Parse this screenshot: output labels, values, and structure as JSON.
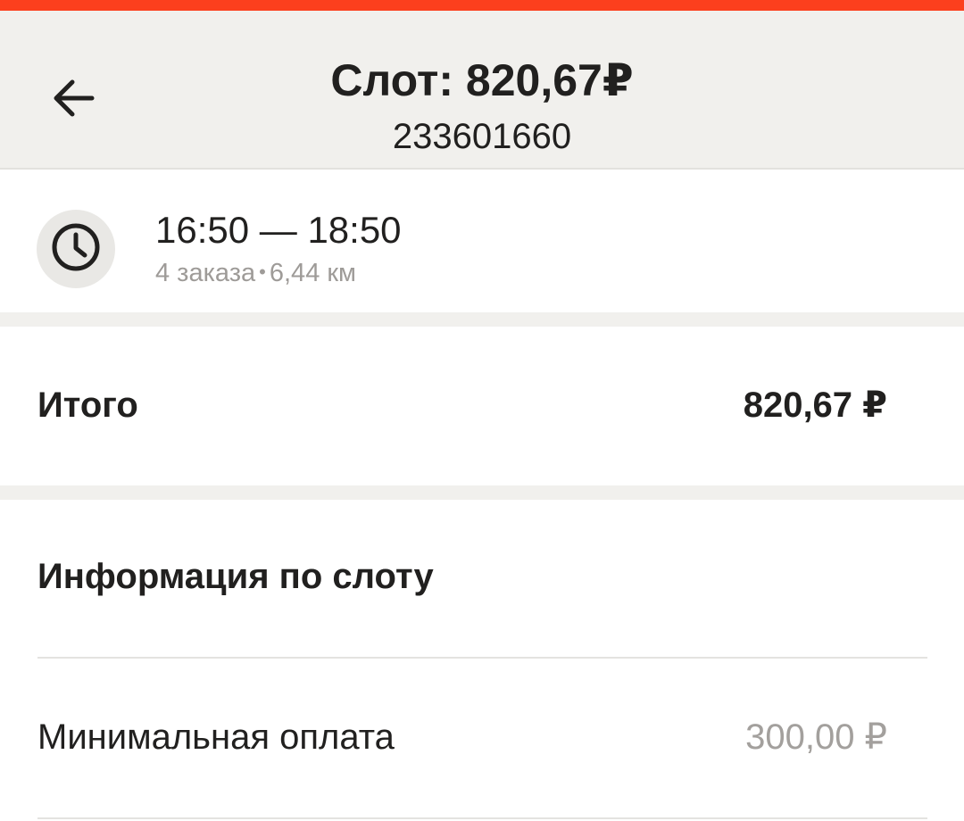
{
  "colors": {
    "accent": "#fc3f1d",
    "header_bg": "#f1f0ed",
    "secondary_text": "#9e9b98"
  },
  "header": {
    "back_icon": "arrow-left-icon",
    "title": "Слот: 820,67₽",
    "subtitle": "233601660"
  },
  "slot": {
    "icon": "clock-icon",
    "time_range": "16:50 — 18:50",
    "orders": "4 заказа",
    "separator": "•",
    "distance": "6,44 км"
  },
  "total": {
    "label": "Итого",
    "value": "820,67 ₽"
  },
  "info": {
    "title": "Информация по слоту",
    "rows": [
      {
        "label": "Минимальная оплата",
        "value": "300,00 ₽"
      }
    ]
  }
}
